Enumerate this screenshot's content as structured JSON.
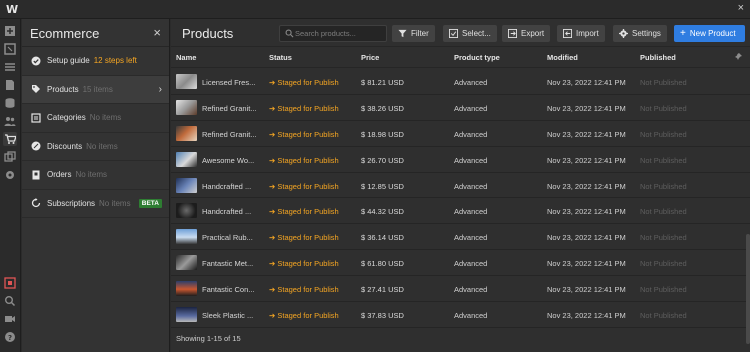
{
  "app": {
    "logo_text": "W",
    "close_glyph": "×"
  },
  "rail": {
    "icons": [
      "add-icon",
      "navigator-icon",
      "layers-icon",
      "pages-icon",
      "cms-icon",
      "users-icon",
      "ecommerce-icon",
      "assets-icon",
      "settings-icon",
      "record-icon",
      "search-icon",
      "video-icon",
      "help-icon"
    ],
    "active": "ecommerce-icon"
  },
  "panel": {
    "title": "Ecommerce",
    "close_glyph": "×",
    "items": [
      {
        "label": "Setup guide",
        "sub": "12 steps left",
        "icon": "check-circle-icon"
      },
      {
        "label": "Products",
        "sub": "15 items",
        "icon": "tag-icon",
        "active": true
      },
      {
        "label": "Categories",
        "sub": "No items",
        "icon": "categories-icon"
      },
      {
        "label": "Discounts",
        "sub": "No items",
        "icon": "discount-icon"
      },
      {
        "label": "Orders",
        "sub": "No items",
        "icon": "orders-icon"
      },
      {
        "label": "Subscriptions",
        "sub": "No items",
        "icon": "subscriptions-icon",
        "badge": "BETA"
      }
    ]
  },
  "main": {
    "title": "Products",
    "search": {
      "placeholder": "Search products..."
    },
    "buttons": {
      "filter": "Filter",
      "select": "Select...",
      "export": "Export",
      "import": "Import",
      "settings": "Settings",
      "new_product": "New Product"
    },
    "columns": [
      "Name",
      "Status",
      "Price",
      "Product type",
      "Modified",
      "Published"
    ],
    "rows": [
      {
        "name": "Licensed Fres...",
        "status": "Staged for Publish",
        "price": "$ 81.21 USD",
        "type": "Advanced",
        "modified": "Nov 23, 2022 12:41 PM",
        "published": "Not Published"
      },
      {
        "name": "Refined Granit...",
        "status": "Staged for Publish",
        "price": "$ 38.26 USD",
        "type": "Advanced",
        "modified": "Nov 23, 2022 12:41 PM",
        "published": "Not Published"
      },
      {
        "name": "Refined Granit...",
        "status": "Staged for Publish",
        "price": "$ 18.98 USD",
        "type": "Advanced",
        "modified": "Nov 23, 2022 12:41 PM",
        "published": "Not Published"
      },
      {
        "name": "Awesome Wo...",
        "status": "Staged for Publish",
        "price": "$ 26.70 USD",
        "type": "Advanced",
        "modified": "Nov 23, 2022 12:41 PM",
        "published": "Not Published"
      },
      {
        "name": "Handcrafted ...",
        "status": "Staged for Publish",
        "price": "$ 12.85 USD",
        "type": "Advanced",
        "modified": "Nov 23, 2022 12:41 PM",
        "published": "Not Published"
      },
      {
        "name": "Handcrafted ...",
        "status": "Staged for Publish",
        "price": "$ 44.32 USD",
        "type": "Advanced",
        "modified": "Nov 23, 2022 12:41 PM",
        "published": "Not Published"
      },
      {
        "name": "Practical Rub...",
        "status": "Staged for Publish",
        "price": "$ 36.14 USD",
        "type": "Advanced",
        "modified": "Nov 23, 2022 12:41 PM",
        "published": "Not Published"
      },
      {
        "name": "Fantastic Met...",
        "status": "Staged for Publish",
        "price": "$ 61.80 USD",
        "type": "Advanced",
        "modified": "Nov 23, 2022 12:41 PM",
        "published": "Not Published"
      },
      {
        "name": "Fantastic Con...",
        "status": "Staged for Publish",
        "price": "$ 27.41 USD",
        "type": "Advanced",
        "modified": "Nov 23, 2022 12:41 PM",
        "published": "Not Published"
      },
      {
        "name": "Sleek Plastic ...",
        "status": "Staged for Publish",
        "price": "$ 37.83 USD",
        "type": "Advanced",
        "modified": "Nov 23, 2022 12:41 PM",
        "published": "Not Published"
      }
    ],
    "footer": "Showing 1-15 of 15"
  },
  "colors": {
    "accent": "#2f7de1",
    "staged": "#f5a623",
    "beta": "#2e7d32"
  }
}
